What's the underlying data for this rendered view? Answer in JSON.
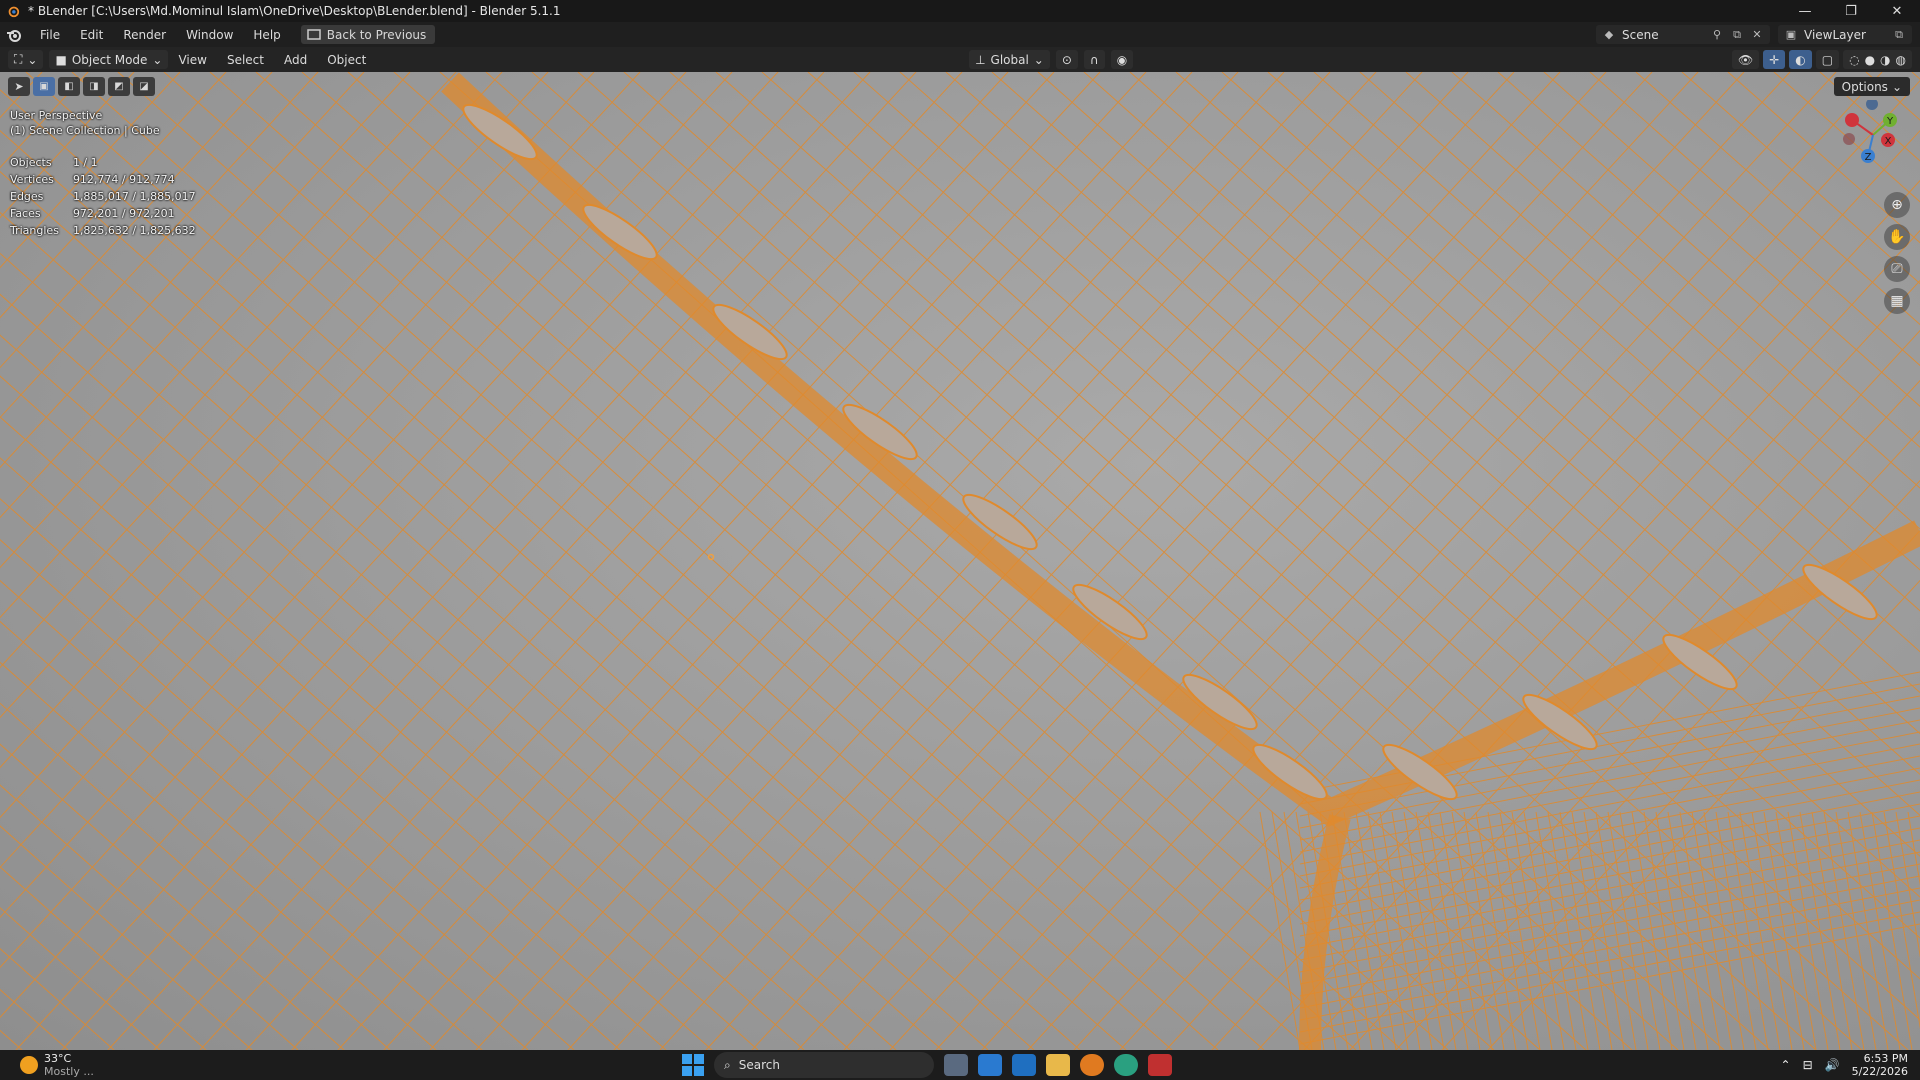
{
  "window": {
    "title": "* BLender [C:\\Users\\Md.Mominul Islam\\OneDrive\\Desktop\\BLender.blend] - Blender 5.1.1",
    "minimize_glyph": "—",
    "maximize_glyph": "❐",
    "close_glyph": "✕"
  },
  "menubar": {
    "items": [
      "File",
      "Edit",
      "Render",
      "Window",
      "Help"
    ],
    "back_button": "Back to Previous",
    "scene": "Scene",
    "view_layer": "ViewLayer"
  },
  "header3d": {
    "mode": "Object Mode",
    "menus": [
      "View",
      "Select",
      "Add",
      "Object"
    ],
    "orientation": "Global"
  },
  "viewport": {
    "overlay_line1": "User Perspective",
    "overlay_line2": "(1) Scene Collection | Cube",
    "options_label": "Options",
    "stats": [
      {
        "label": "Objects",
        "value": "1 / 1"
      },
      {
        "label": "Vertices",
        "value": "912,774 / 912,774"
      },
      {
        "label": "Edges",
        "value": "1,885,017 / 1,885,017"
      },
      {
        "label": "Faces",
        "value": "972,201 / 972,201"
      },
      {
        "label": "Triangles",
        "value": "1,825,632 / 1,825,632"
      }
    ],
    "gizmo": {
      "x": "X",
      "y": "Y",
      "z": "Z"
    },
    "colors": {
      "wire": "#e08a2c",
      "background": "#9d9d9d",
      "x_axis": "#d0343c",
      "y_axis": "#70b030",
      "z_axis": "#3a7fd0"
    }
  },
  "taskbar": {
    "temperature": "33°C",
    "weather_sub": "Mostly ...",
    "search_placeholder": "Search",
    "time": "6:53 PM",
    "date": "5/22/2026"
  }
}
